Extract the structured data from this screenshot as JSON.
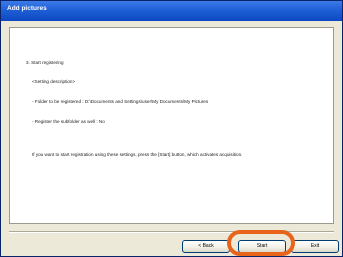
{
  "window": {
    "title": "Add pictures"
  },
  "content": {
    "step_heading": "3. Start registering",
    "settings_label": "<Setting description>",
    "folder_line": "- Folder to be registered :   D:\\Documents and Settings\\user\\My Documents\\My Pictures",
    "subfolder_line": "- Register the subfolder as well :   No",
    "instruction": "If you want to start registration using these settings, press the [Start] button, which activates acquisition."
  },
  "buttons": {
    "back_label": "< Back",
    "start_label": "Start",
    "exit_label": "Exit"
  },
  "colors": {
    "highlight": "#e8641b",
    "titlebar": "#1f5fd6"
  }
}
